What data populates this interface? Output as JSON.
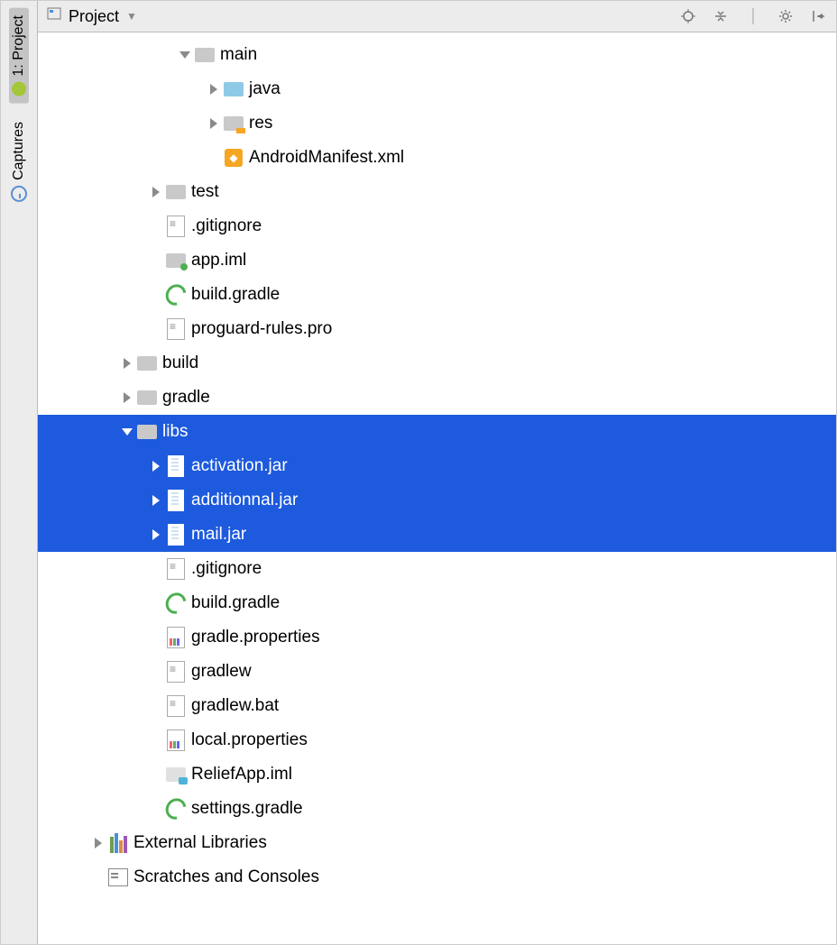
{
  "side_tabs": {
    "project": "1: Project",
    "captures": "Captures"
  },
  "header": {
    "title": "Project"
  },
  "tree": [
    {
      "indent": 4,
      "arrow": "down",
      "icon": "folder",
      "label": "main",
      "sel": false
    },
    {
      "indent": 5,
      "arrow": "right",
      "icon": "folder-blue",
      "label": "java",
      "sel": false
    },
    {
      "indent": 5,
      "arrow": "right",
      "icon": "res",
      "label": "res",
      "sel": false
    },
    {
      "indent": 5,
      "arrow": "none",
      "icon": "manifest",
      "label": "AndroidManifest.xml",
      "sel": false
    },
    {
      "indent": 3,
      "arrow": "right",
      "icon": "folder",
      "label": "test",
      "sel": false
    },
    {
      "indent": 3,
      "arrow": "none",
      "icon": "file",
      "label": ".gitignore",
      "sel": false
    },
    {
      "indent": 3,
      "arrow": "none",
      "icon": "iml",
      "label": "app.iml",
      "sel": false
    },
    {
      "indent": 3,
      "arrow": "none",
      "icon": "gradle",
      "label": "build.gradle",
      "sel": false
    },
    {
      "indent": 3,
      "arrow": "none",
      "icon": "file",
      "label": "proguard-rules.pro",
      "sel": false
    },
    {
      "indent": 2,
      "arrow": "right",
      "icon": "folder",
      "label": "build",
      "sel": false
    },
    {
      "indent": 2,
      "arrow": "right",
      "icon": "folder",
      "label": "gradle",
      "sel": false
    },
    {
      "indent": 2,
      "arrow": "down",
      "icon": "folder",
      "label": "libs",
      "sel": true
    },
    {
      "indent": 3,
      "arrow": "right",
      "icon": "jar",
      "label": "activation.jar",
      "sel": true
    },
    {
      "indent": 3,
      "arrow": "right",
      "icon": "jar",
      "label": "additionnal.jar",
      "sel": true
    },
    {
      "indent": 3,
      "arrow": "right",
      "icon": "jar",
      "label": "mail.jar",
      "sel": true
    },
    {
      "indent": 3,
      "arrow": "none",
      "icon": "file",
      "label": ".gitignore",
      "sel": false
    },
    {
      "indent": 3,
      "arrow": "none",
      "icon": "gradle",
      "label": "build.gradle",
      "sel": false
    },
    {
      "indent": 3,
      "arrow": "none",
      "icon": "prop",
      "label": "gradle.properties",
      "sel": false
    },
    {
      "indent": 3,
      "arrow": "none",
      "icon": "file",
      "label": "gradlew",
      "sel": false
    },
    {
      "indent": 3,
      "arrow": "none",
      "icon": "file",
      "label": "gradlew.bat",
      "sel": false
    },
    {
      "indent": 3,
      "arrow": "none",
      "icon": "prop",
      "label": "local.properties",
      "sel": false
    },
    {
      "indent": 3,
      "arrow": "none",
      "icon": "imlcup",
      "label": "ReliefApp.iml",
      "sel": false
    },
    {
      "indent": 3,
      "arrow": "none",
      "icon": "gradle",
      "label": "settings.gradle",
      "sel": false
    },
    {
      "indent": 1,
      "arrow": "right",
      "icon": "libs-ext",
      "label": "External Libraries",
      "sel": false
    },
    {
      "indent": 1,
      "arrow": "none",
      "icon": "scratch",
      "label": "Scratches and Consoles",
      "sel": false
    }
  ]
}
